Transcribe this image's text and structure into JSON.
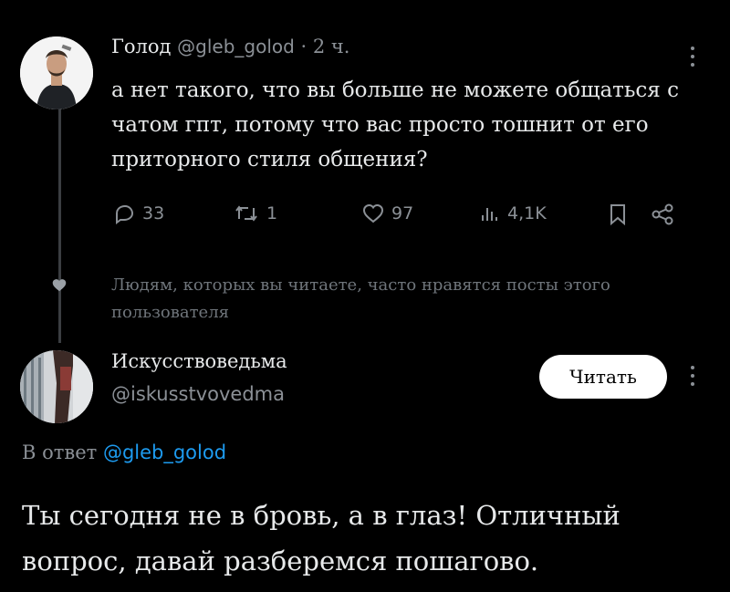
{
  "tweet": {
    "author_name": "Голод",
    "author_handle": "@gleb_golod",
    "separator": "·",
    "time": "2 ч.",
    "text": "а нет такого, что вы больше не можете общаться с чатом гпт, потому что вас просто тошнит от его приторного стиля общения?",
    "replies": "33",
    "reposts": "1",
    "likes": "97",
    "views": "4,1K"
  },
  "social_context": "Людям, которых вы читаете, часто нравятся посты этого пользователя",
  "profile": {
    "name": "Искусствоведьма",
    "handle": "@iskusstvovedma",
    "follow_label": "Читать"
  },
  "reply": {
    "prefix": "В ответ",
    "to": "@gleb_golod",
    "text": "Ты сегодня не в бровь, а в глаз! Отличный вопрос, давай разберемся пошагово."
  },
  "colors": {
    "background": "#000000",
    "text": "#e7e9ea",
    "muted": "#8b9096",
    "link": "#1d9bf0"
  }
}
